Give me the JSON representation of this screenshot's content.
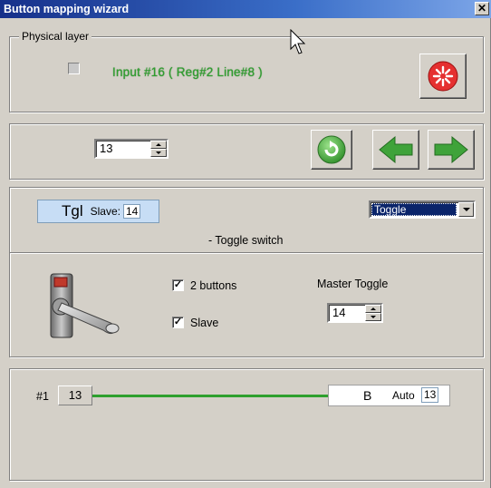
{
  "window": {
    "title": "Button mapping wizard",
    "close_glyph": "✕"
  },
  "physical_layer": {
    "legend": "Physical layer",
    "input_status": "Input #16  ( Reg#2  Line#8 )",
    "status_color": "#2ea02e",
    "red_button_icon": "red-flower-icon"
  },
  "navigation": {
    "spinner_value": "13",
    "refresh_icon": "refresh-icon",
    "back_icon": "left-arrow-icon",
    "forward_icon": "right-arrow-icon"
  },
  "mode": {
    "tgl_label": "Tgl",
    "slave_label": "Slave:",
    "slave_value": "14",
    "dropdown_value": "Toggle",
    "description": "- Toggle switch",
    "two_buttons_label": "2 buttons",
    "two_buttons_checked": true,
    "slave_checkbox_label": "Slave",
    "slave_checked": true,
    "master_toggle_label": "Master Toggle",
    "master_toggle_value": "14",
    "check_glyph": "✓"
  },
  "mapping": {
    "index_label": "#1",
    "input_value": "13",
    "target_letter": "B",
    "auto_label": "Auto",
    "auto_value": "13",
    "line_color": "#2ea02e"
  }
}
